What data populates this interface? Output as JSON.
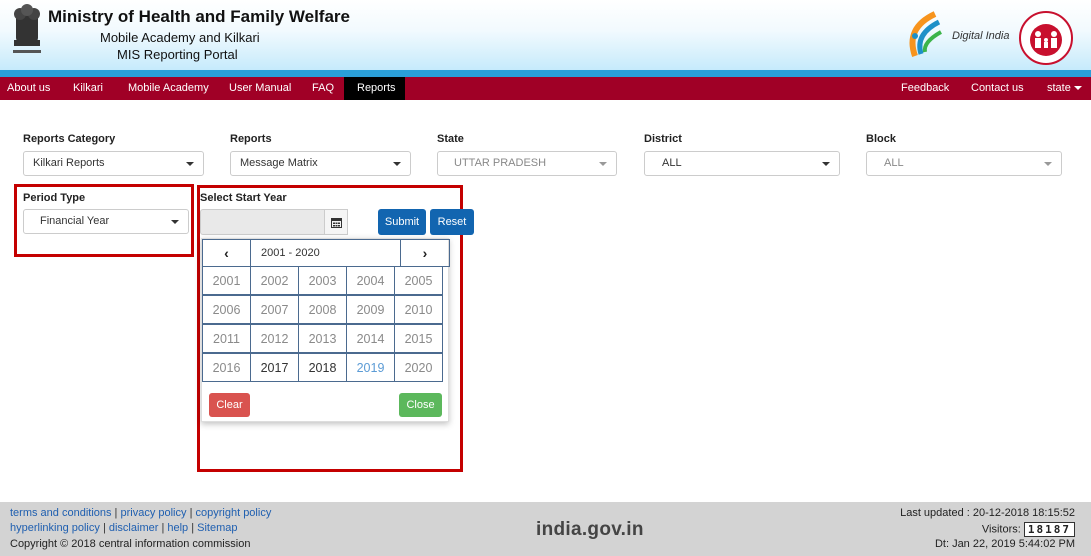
{
  "header": {
    "title": "Ministry of Health and Family Welfare",
    "subtitle1": "Mobile Academy and Kilkari",
    "subtitle2": "MIS Reporting Portal",
    "digital_india": "Digital India"
  },
  "nav": {
    "left": [
      "About us",
      "Kilkari",
      "Mobile Academy",
      "User Manual",
      "FAQ",
      "Reports"
    ],
    "active": "Reports",
    "right": [
      "Feedback",
      "Contact us"
    ],
    "user": "state"
  },
  "form": {
    "reports_category": {
      "label": "Reports Category",
      "value": "Kilkari Reports"
    },
    "reports": {
      "label": "Reports",
      "value": "Message Matrix"
    },
    "state": {
      "label": "State",
      "value": "UTTAR PRADESH"
    },
    "district": {
      "label": "District",
      "value": "ALL"
    },
    "block": {
      "label": "Block",
      "value": "ALL"
    },
    "period_type": {
      "label": "Period Type",
      "value": "Financial Year"
    },
    "start_year": {
      "label": "Select Start Year",
      "value": ""
    },
    "submit_label": "Submit",
    "reset_label": "Reset"
  },
  "calendar": {
    "range": "2001 - 2020",
    "years": [
      [
        "2001",
        "2002",
        "2003",
        "2004",
        "2005"
      ],
      [
        "2006",
        "2007",
        "2008",
        "2009",
        "2010"
      ],
      [
        "2011",
        "2012",
        "2013",
        "2014",
        "2015"
      ],
      [
        "2016",
        "2017",
        "2018",
        "2019",
        "2020"
      ]
    ],
    "enabled_years": [
      "2017",
      "2018"
    ],
    "highlighted_year": "2019",
    "clear_label": "Clear",
    "close_label": "Close"
  },
  "footer": {
    "links_line1": [
      "terms and conditions",
      "privacy policy",
      "copyright policy"
    ],
    "links_line2": [
      "hyperlinking policy",
      "disclaimer",
      "help",
      "Sitemap"
    ],
    "copyright": "Copyright © 2018 central information commission",
    "logo_text": "india.gov.in",
    "last_updated": "Last updated : 20-12-2018 18:15:52",
    "visitors_label": "Visitors:",
    "visitors_count": "18187",
    "datetime": "Dt: Jan 22, 2019 5:44:02 PM"
  },
  "colors": {
    "navbar": "#a00026",
    "highlight_box": "#c40000",
    "primary_button": "#1265b0",
    "clear_button": "#d9534f",
    "close_button": "#5cb85c"
  }
}
